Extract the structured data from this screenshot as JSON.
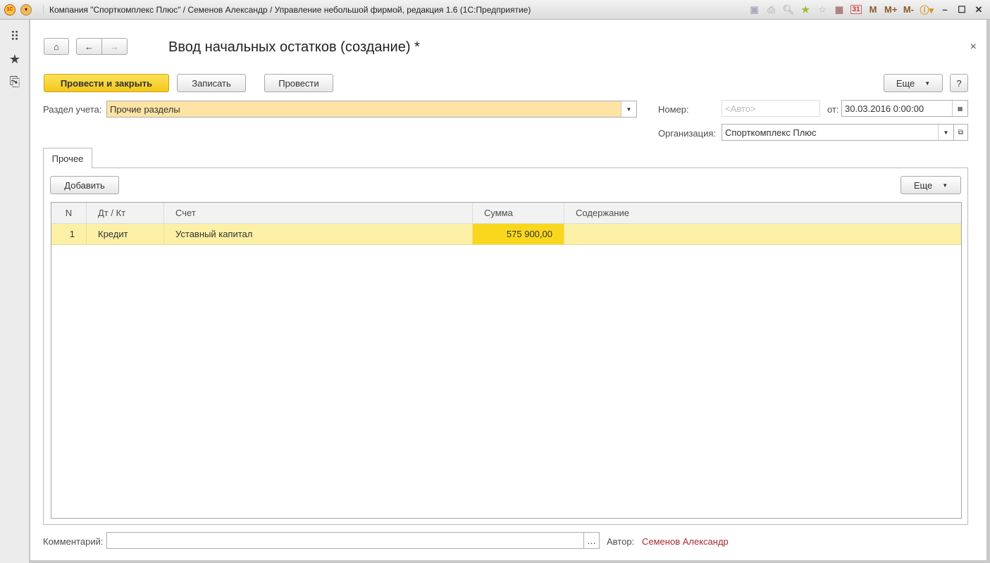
{
  "window": {
    "title": "Компания \"Спорткомплекс Плюс\" / Семенов Александр / Управление небольшой фирмой, редакция 1.6  (1С:Предприятие)",
    "logo": "1С",
    "toolbar_m": "M",
    "toolbar_mplus": "M+",
    "toolbar_mminus": "M-",
    "calendar_day": "31"
  },
  "form": {
    "title": "Ввод начальных остатков (создание) *",
    "close": "×"
  },
  "buttons": {
    "post_close": "Провести и закрыть",
    "save": "Записать",
    "post": "Провести",
    "more": "Еще",
    "help": "?",
    "add": "Добавить",
    "more2": "Еще"
  },
  "fields": {
    "section_label": "Раздел учета:",
    "section_value": "Прочие разделы",
    "number_label": "Номер:",
    "number_placeholder": "<Авто>",
    "date_label": "от:",
    "date_value": "30.03.2016  0:00:00",
    "org_label": "Организация:",
    "org_value": "Спорткомплекс Плюс",
    "comment_label": "Комментарий:",
    "comment_value": "",
    "author_label": "Автор:",
    "author_value": "Семенов Александр"
  },
  "tabs": [
    {
      "label": "Прочее"
    }
  ],
  "table": {
    "columns": [
      "N",
      "Дт / Кт",
      "Счет",
      "Сумма",
      "Содержание"
    ],
    "rows": [
      {
        "n": "1",
        "dtkt": "Кредит",
        "account": "Уставный капитал",
        "sum": "575 900,00",
        "content": ""
      }
    ]
  },
  "colors": {
    "accent": "#f3c71b",
    "selected_row": "#fbf0a6",
    "author": "#a52a2a"
  }
}
